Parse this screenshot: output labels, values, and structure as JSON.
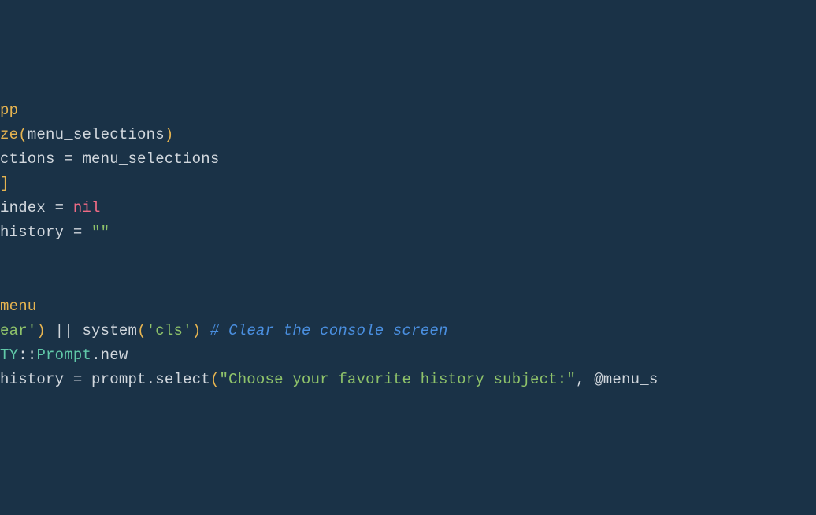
{
  "code": {
    "lines": [
      {
        "tokens": [
          {
            "t": "pp",
            "c": "tok-keyword"
          }
        ]
      },
      {
        "tokens": [
          {
            "t": "ze",
            "c": "tok-keyword"
          },
          {
            "t": "(",
            "c": "tok-paren-yellow"
          },
          {
            "t": "menu_selections",
            "c": "tok-ident"
          },
          {
            "t": ")",
            "c": "tok-paren-yellow"
          }
        ]
      },
      {
        "tokens": [
          {
            "t": "ctions",
            "c": "tok-ident"
          },
          {
            "t": " = ",
            "c": "tok-punct"
          },
          {
            "t": "menu_selections",
            "c": "tok-ident"
          }
        ]
      },
      {
        "tokens": [
          {
            "t": "]",
            "c": "tok-bracket-yellow"
          }
        ]
      },
      {
        "tokens": [
          {
            "t": "index",
            "c": "tok-ident"
          },
          {
            "t": " = ",
            "c": "tok-punct"
          },
          {
            "t": "nil",
            "c": "tok-nil"
          }
        ]
      },
      {
        "tokens": [
          {
            "t": "history",
            "c": "tok-ident"
          },
          {
            "t": " = ",
            "c": "tok-punct"
          },
          {
            "t": "\"\"",
            "c": "tok-string"
          }
        ]
      },
      {
        "tokens": []
      },
      {
        "tokens": []
      },
      {
        "tokens": [
          {
            "t": "menu",
            "c": "tok-keyword"
          }
        ]
      },
      {
        "tokens": [
          {
            "t": "ear'",
            "c": "tok-string"
          },
          {
            "t": ")",
            "c": "tok-paren-yellow"
          },
          {
            "t": " || ",
            "c": "tok-punct"
          },
          {
            "t": "system",
            "c": "tok-ident"
          },
          {
            "t": "(",
            "c": "tok-paren-yellow"
          },
          {
            "t": "'cls'",
            "c": "tok-string"
          },
          {
            "t": ")",
            "c": "tok-paren-yellow"
          },
          {
            "t": " ",
            "c": "tok-punct"
          },
          {
            "t": "# Clear the console screen",
            "c": "tok-comment"
          }
        ]
      },
      {
        "tokens": [
          {
            "t": "TY",
            "c": "tok-const"
          },
          {
            "t": "::",
            "c": "tok-punct"
          },
          {
            "t": "Prompt",
            "c": "tok-const"
          },
          {
            "t": ".",
            "c": "tok-punct"
          },
          {
            "t": "new",
            "c": "tok-method"
          }
        ]
      },
      {
        "tokens": [
          {
            "t": "history",
            "c": "tok-ident"
          },
          {
            "t": " = ",
            "c": "tok-punct"
          },
          {
            "t": "prompt",
            "c": "tok-ident"
          },
          {
            "t": ".",
            "c": "tok-punct"
          },
          {
            "t": "select",
            "c": "tok-method"
          },
          {
            "t": "(",
            "c": "tok-paren-yellow"
          },
          {
            "t": "\"Choose your favorite history subject:\"",
            "c": "tok-string"
          },
          {
            "t": ", ",
            "c": "tok-punct"
          },
          {
            "t": "@menu_s",
            "c": "tok-ivar"
          }
        ]
      }
    ]
  }
}
